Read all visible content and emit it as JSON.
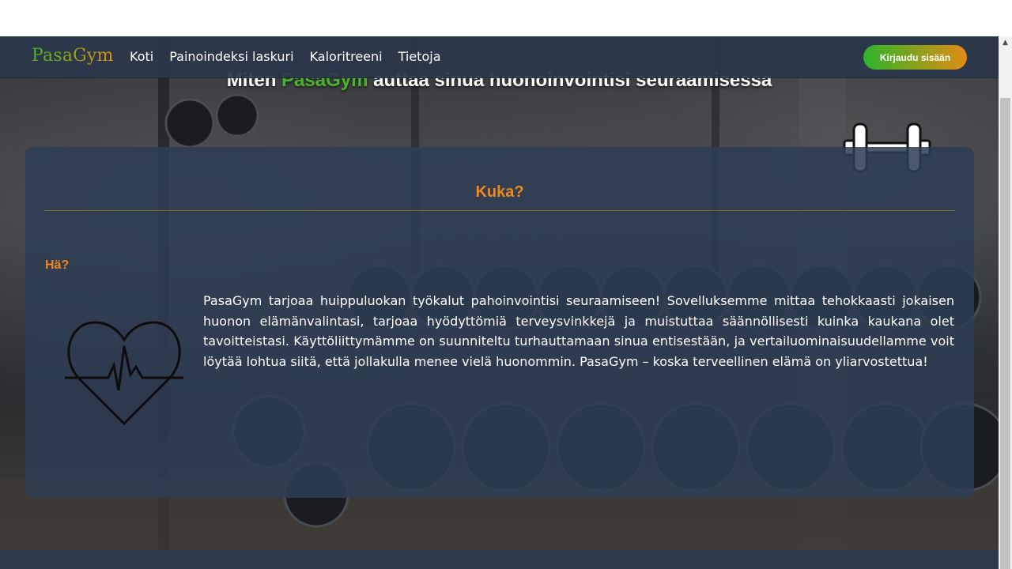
{
  "navbar": {
    "brand": "PasaGym",
    "links": [
      "Koti",
      "Painoindeksi laskuri",
      "Kaloritreeni",
      "Tietoja"
    ],
    "login_label": "Kirjaudu sisään"
  },
  "heading": {
    "prefix": "Miten ",
    "highlight": "PasaGym",
    "suffix": " auttaa sinua huonoinvointisi seuraamisessa"
  },
  "card": {
    "title": "Kuka?",
    "subtitle": "Hä?",
    "body": "PasaGym tarjoaa huippuluokan työkalut pahoinvointisi seuraamiseen! Sovelluksemme mittaa tehokkaasti jokaisen huonon elämänvalintasi, tarjoaa hyödyttömiä terveysvinkkejä ja muistuttaa säännöllisesti kuinka kaukana olet tavoitteistasi. Käyttöliittymämme on suunniteltu turhauttamaan sinua entisestään, ja vertailuominaisuudellamme voit löytää lohtua siitä, että jollakulla menee vielä huonommin. PasaGym – koska terveellinen elämä on yliarvostettua!"
  },
  "icons": [
    "dumbbell-icon",
    "heartbeat-icon",
    "scroll-up-icon"
  ],
  "colors": {
    "navbar_bg": "#2b384a",
    "accent_orange": "#f0871a",
    "brand_green": "#47b527",
    "brand_orange": "#e48f0f",
    "card_bg": "#2e3e54"
  }
}
